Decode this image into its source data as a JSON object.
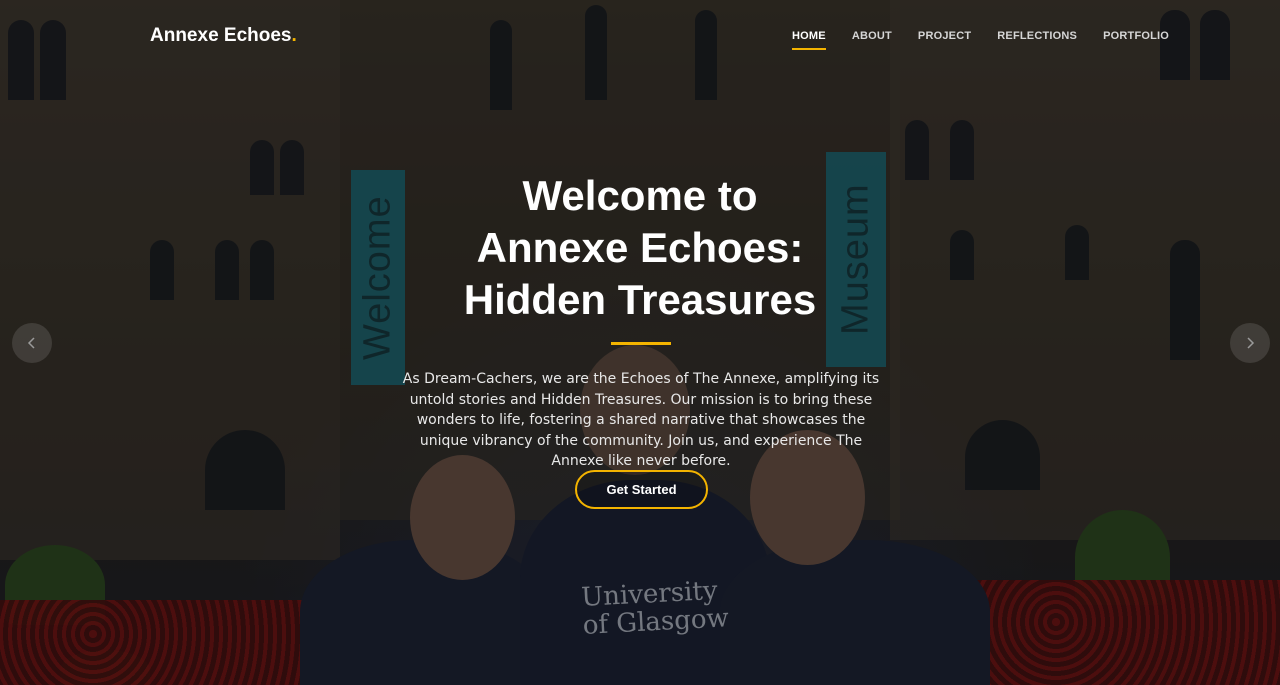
{
  "brand": {
    "name": "Annexe Echoes",
    "dot": ".",
    "accent_color": "#f4b400"
  },
  "nav": {
    "items": [
      {
        "label": "HOME",
        "active": true
      },
      {
        "label": "ABOUT",
        "active": false
      },
      {
        "label": "PROJECT",
        "active": false
      },
      {
        "label": "REFLECTIONS",
        "active": false
      },
      {
        "label": "PORTFOLIO",
        "active": false
      }
    ]
  },
  "hero": {
    "headline_lines": [
      "Welcome to",
      "Annexe Echoes:",
      "Hidden Treasures"
    ],
    "description": "As Dream-Cachers, we are the Echoes of The Annexe, amplifying its untold stories and Hidden Treasures. Our mission is to bring these wonders to life, fostering a shared narrative that showcases the unique vibrancy of the community. Join us, and experience The Annexe like never before.",
    "cta_label": "Get Started",
    "banner_left": "Welcome",
    "banner_right": "Museum",
    "hoodie_text": "University of Glasgow"
  },
  "carousel": {
    "prev_icon": "chevron-left-icon",
    "next_icon": "chevron-right-icon"
  }
}
